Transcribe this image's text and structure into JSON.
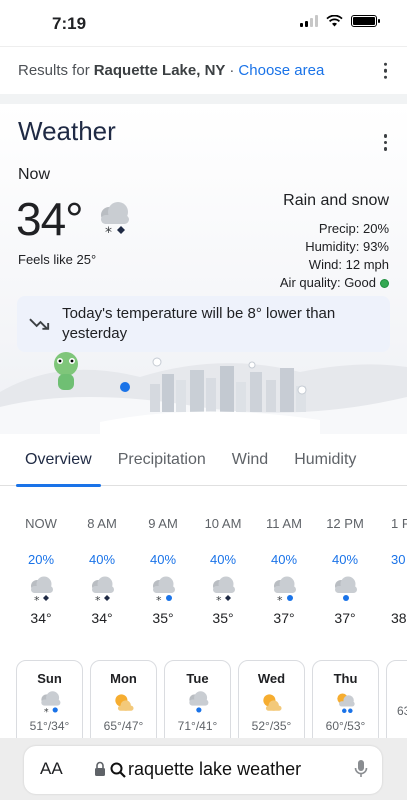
{
  "status": {
    "time": "7:19"
  },
  "results": {
    "prefix": "Results for",
    "location": "Raquette Lake, NY",
    "separator": "·",
    "choose_area": "Choose area"
  },
  "weather": {
    "title": "Weather",
    "now_label": "Now",
    "temp": "34°",
    "feels_like": "Feels like 25°",
    "condition": "Rain and snow",
    "precip": "Precip: 20%",
    "humidity": "Humidity: 93%",
    "wind": "Wind: 12 mph",
    "air_quality": "Air quality: Good",
    "air_quality_color": "#34a853",
    "banner": "Today's temperature will be 8° lower than yesterday"
  },
  "tabs": [
    "Overview",
    "Precipitation",
    "Wind",
    "Humidity"
  ],
  "hourly": [
    {
      "time": "NOW",
      "precip": "20%",
      "icon": "cloud-snow-rain-icon",
      "temp": "34°"
    },
    {
      "time": "8 AM",
      "precip": "40%",
      "icon": "cloud-snow-rain-icon",
      "temp": "34°"
    },
    {
      "time": "9 AM",
      "precip": "40%",
      "icon": "cloud-snow-rain-icon",
      "temp": "35°"
    },
    {
      "time": "10 AM",
      "precip": "40%",
      "icon": "cloud-snow-rain-icon",
      "temp": "35°"
    },
    {
      "time": "11 AM",
      "precip": "40%",
      "icon": "cloud-snow-rain-icon",
      "temp": "37°"
    },
    {
      "time": "12 PM",
      "precip": "40%",
      "icon": "cloud-rain-icon",
      "temp": "37°"
    },
    {
      "time": "1 P",
      "precip": "30",
      "icon": "cloud-rain-icon",
      "temp": "38"
    }
  ],
  "daily": [
    {
      "day": "Sun",
      "icon": "cloud-snow-rain-icon",
      "range": "51°/34°"
    },
    {
      "day": "Mon",
      "icon": "partly-sunny-icon",
      "range": "65°/47°"
    },
    {
      "day": "Tue",
      "icon": "cloud-rain-icon",
      "range": "71°/41°"
    },
    {
      "day": "Wed",
      "icon": "partly-sunny-icon",
      "range": "52°/35°"
    },
    {
      "day": "Thu",
      "icon": "sun-rain-icon",
      "range": "60°/53°"
    },
    {
      "day": "",
      "icon": "",
      "range": "63"
    }
  ],
  "browser": {
    "aa": "AA",
    "query": "raquette lake weather"
  }
}
